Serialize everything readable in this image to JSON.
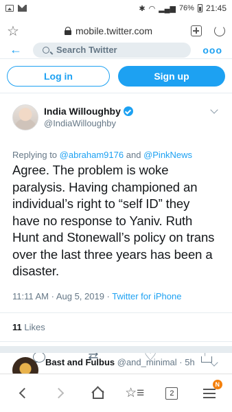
{
  "status_bar": {
    "battery": "76%",
    "time": "21:45"
  },
  "browser": {
    "url": "mobile.twitter.com",
    "star_icon": "star-icon",
    "lock_icon": "lock-icon",
    "new_tab_icon": "plus-box-icon",
    "reload_icon": "reload-icon"
  },
  "twitter_header": {
    "search_placeholder": "Search Twitter",
    "more": "ooo"
  },
  "auth": {
    "login_label": "Log in",
    "signup_label": "Sign up"
  },
  "tweet": {
    "author_name": "India Willoughby",
    "author_handle": "@IndiaWilloughby",
    "verified": true,
    "replying_prefix": "Replying to",
    "reply_to_1": "@abraham9176",
    "reply_and": "and",
    "reply_to_2": "@PinkNews",
    "text": "Agree. The problem is woke paralysis. Having championed an individual’s right to “self ID” they have no response to Yaniv. Ruth Hunt and Stonewall’s policy on trans over the last three years has been a disaster.",
    "time": "11:11 AM · Aug 5, 2019 · ",
    "client": "Twitter for iPhone",
    "likes_count": "11",
    "likes_label": "Likes"
  },
  "next_tweet": {
    "author_name": "Bast and Fulbus",
    "author_handle": "@and_minimal",
    "age": "· 5h"
  },
  "toolbar": {
    "tab_count": "2",
    "menu_badge": "N"
  },
  "colors": {
    "twitter_blue": "#1da1f2",
    "muted_text": "#657786",
    "badge_orange": "#f4800c"
  }
}
